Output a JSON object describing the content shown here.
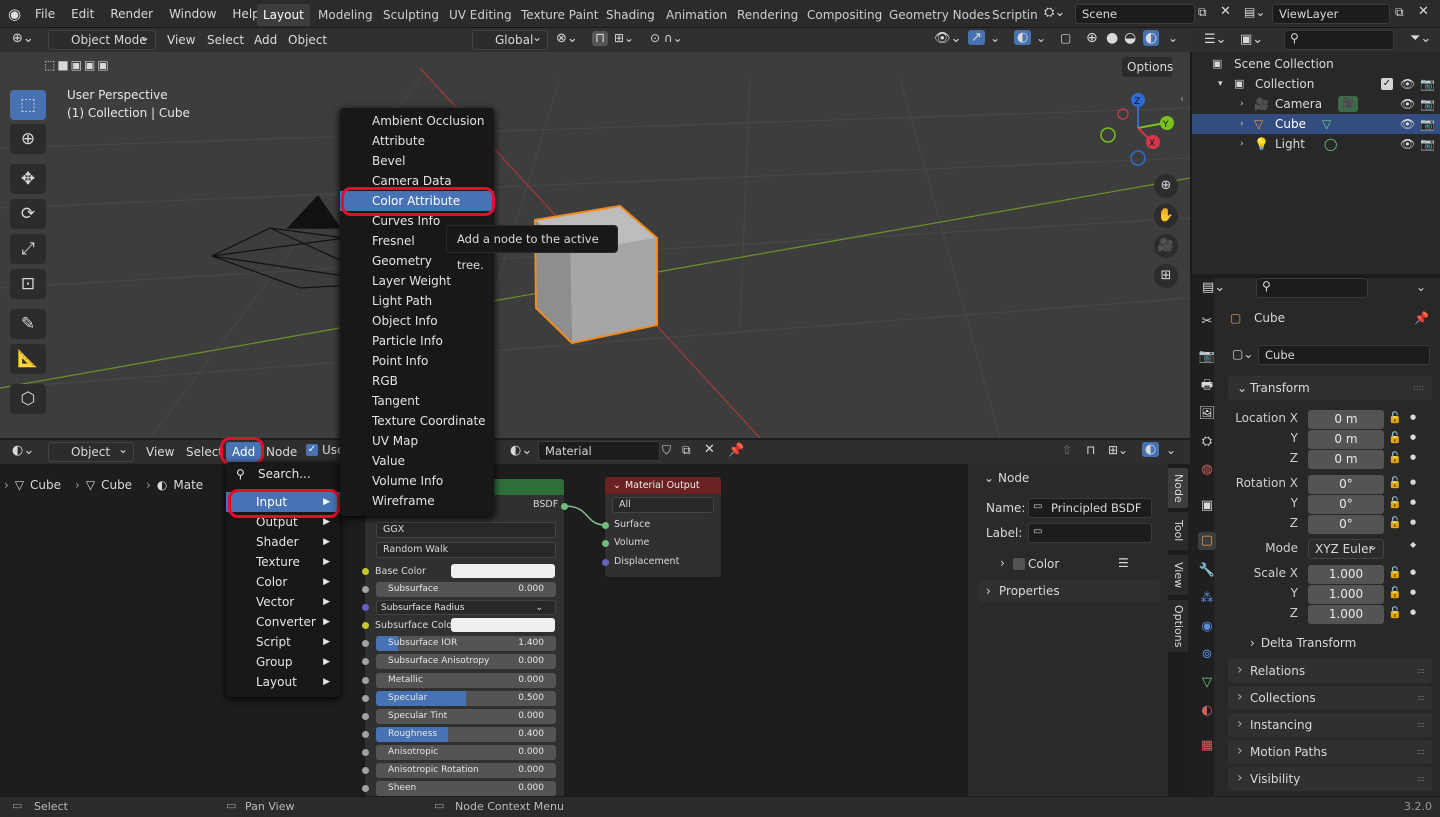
{
  "menu": [
    "File",
    "Edit",
    "Render",
    "Window",
    "Help"
  ],
  "workspaces": [
    "Layout",
    "Modeling",
    "Sculpting",
    "UV Editing",
    "Texture Paint",
    "Shading",
    "Animation",
    "Rendering",
    "Compositing",
    "Geometry Nodes",
    "Scripting"
  ],
  "scene": "Scene",
  "viewlayer": "ViewLayer",
  "viewport": {
    "mode": "Object Mode",
    "menus": [
      "View",
      "Select",
      "Add",
      "Object"
    ],
    "transform": "Global",
    "options": "Options",
    "overlay1": "User Perspective",
    "overlay2": "(1) Collection | Cube"
  },
  "node_header": {
    "type": "Object",
    "menus": [
      "View",
      "Select",
      "Add",
      "Node"
    ],
    "use": "Use",
    "material": "Material"
  },
  "breadcrumb": [
    "Cube",
    "Cube",
    "Mate"
  ],
  "add_menu": {
    "search": "Search...",
    "items": [
      "Input",
      "Output",
      "Shader",
      "Texture",
      "Color",
      "Vector",
      "Converter",
      "Script",
      "Group",
      "Layout"
    ]
  },
  "input_menu": [
    "Ambient Occlusion",
    "Attribute",
    "Bevel",
    "Camera Data",
    "Color Attribute",
    "Curves Info",
    "Fresnel",
    "Geometry",
    "Layer Weight",
    "Light Path",
    "Object Info",
    "Particle Info",
    "Point Info",
    "RGB",
    "Tangent",
    "Texture Coordinate",
    "UV Map",
    "Value",
    "Volume Info",
    "Wireframe"
  ],
  "tooltip": "Add a node to the active tree.",
  "bsdf_node": {
    "out": "BSDF",
    "dist": "GGX",
    "sss": "Random Walk",
    "rows": [
      {
        "label": "Base Color",
        "type": "color"
      },
      {
        "label": "Subsurface",
        "value": "0.000",
        "fill": 0
      },
      {
        "label": "Subsurface Radius",
        "type": "drop"
      },
      {
        "label": "Subsurface Color",
        "type": "color"
      },
      {
        "label": "Subsurface IOR",
        "value": "1.400",
        "fill": 0.12
      },
      {
        "label": "Subsurface Anisotropy",
        "value": "0.000",
        "fill": 0
      },
      {
        "label": "Metallic",
        "value": "0.000",
        "fill": 0
      },
      {
        "label": "Specular",
        "value": "0.500",
        "fill": 0.5
      },
      {
        "label": "Specular Tint",
        "value": "0.000",
        "fill": 0
      },
      {
        "label": "Roughness",
        "value": "0.400",
        "fill": 0.4
      },
      {
        "label": "Anisotropic",
        "value": "0.000",
        "fill": 0
      },
      {
        "label": "Anisotropic Rotation",
        "value": "0.000",
        "fill": 0
      },
      {
        "label": "Sheen",
        "value": "0.000",
        "fill": 0
      }
    ]
  },
  "mat_output": {
    "title": "Material Output",
    "target": "All",
    "inputs": [
      "Surface",
      "Volume",
      "Displacement"
    ]
  },
  "node_panel": {
    "title": "Node",
    "name_label": "Name:",
    "name": "Principled BSDF",
    "label_label": "Label:",
    "color": "Color",
    "properties": "Properties"
  },
  "sidebar_tabs": [
    "Node",
    "Tool",
    "View",
    "Options"
  ],
  "outliner": {
    "root": "Scene Collection",
    "collection": "Collection",
    "items": [
      "Camera",
      "Cube",
      "Light"
    ]
  },
  "properties": {
    "object": "Cube",
    "data_name": "Cube",
    "transform": "Transform",
    "loc_label": "Location X",
    "rot_label": "Rotation X",
    "scale_label": "Scale X",
    "y": "Y",
    "z": "Z",
    "loc": [
      "0 m",
      "0 m",
      "0 m"
    ],
    "rot": [
      "0°",
      "0°",
      "0°"
    ],
    "scale": [
      "1.000",
      "1.000",
      "1.000"
    ],
    "mode_label": "Mode",
    "mode": "XYZ Euler",
    "delta": "Delta Transform",
    "panels": [
      "Relations",
      "Collections",
      "Instancing",
      "Motion Paths",
      "Visibility"
    ]
  },
  "status": {
    "select": "Select",
    "pan": "Pan View",
    "ctx": "Node Context Menu",
    "version": "3.2.0"
  },
  "axes": {
    "x": "X",
    "y": "Y",
    "z": "Z"
  }
}
